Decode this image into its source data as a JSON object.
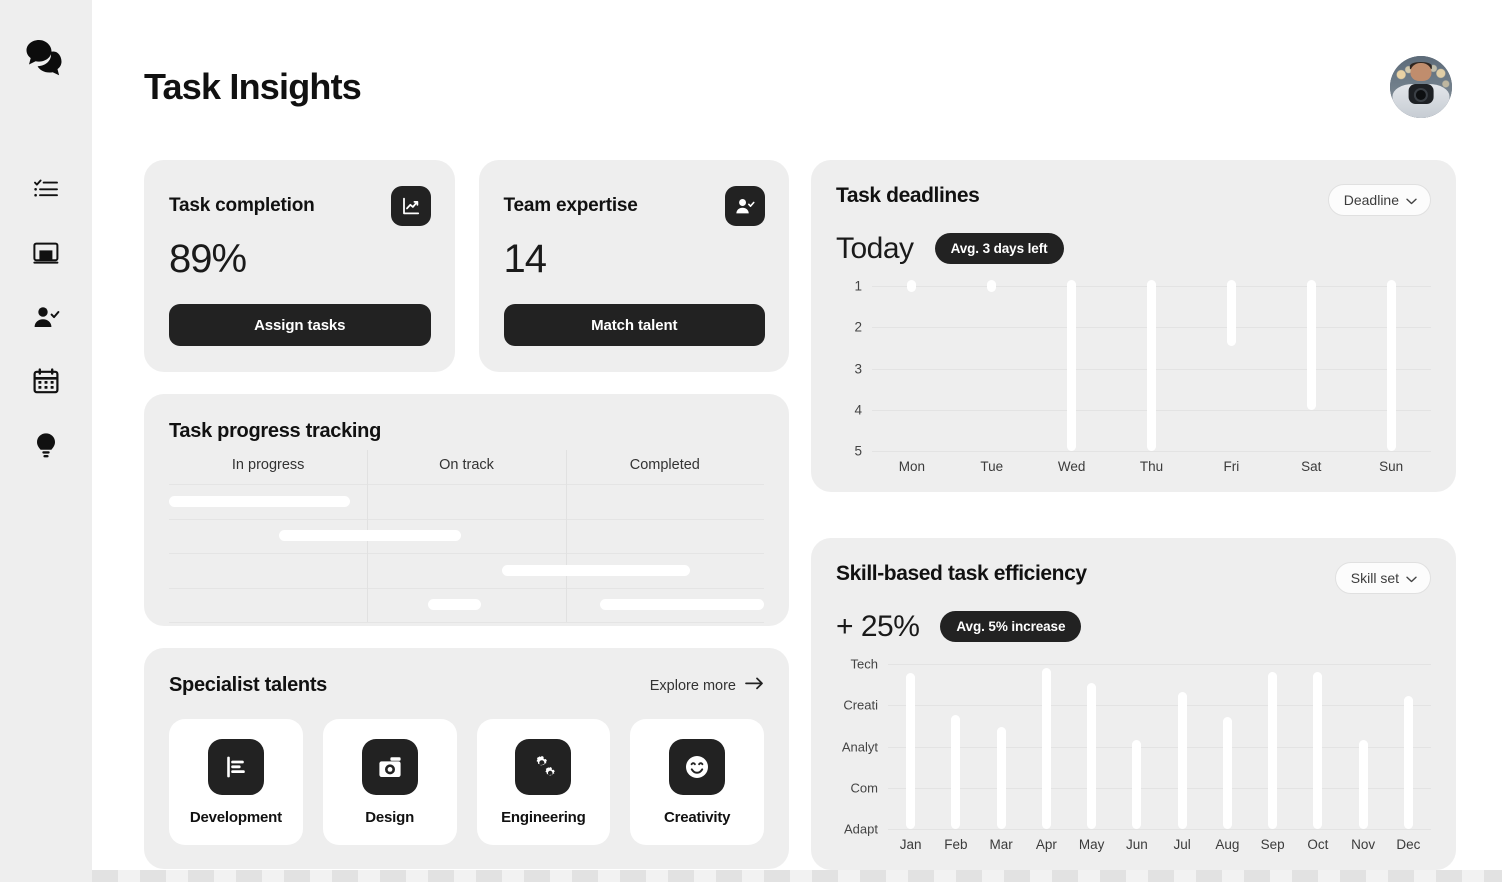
{
  "accent": "#222222",
  "surface": "#eeeeee",
  "background": "#ffffff",
  "sidebar": {
    "logo_icon": "chat-bubbles-icon",
    "items": [
      {
        "icon": "checklist-icon",
        "name": "tasks"
      },
      {
        "icon": "board-icon",
        "name": "board"
      },
      {
        "icon": "user-check-icon",
        "name": "people"
      },
      {
        "icon": "calendar-icon",
        "name": "calendar"
      },
      {
        "icon": "lightbulb-icon",
        "name": "ideas"
      }
    ]
  },
  "header": {
    "title": "Task Insights",
    "avatar_icon": "user-avatar-photo"
  },
  "stats": [
    {
      "title": "Task completion",
      "value": "89%",
      "button": "Assign tasks",
      "icon": "line-chart-icon"
    },
    {
      "title": "Team expertise",
      "value": "14",
      "button": "Match talent",
      "icon": "user-check-icon"
    }
  ],
  "progress": {
    "title": "Task progress tracking",
    "columns": [
      "In progress",
      "On track",
      "Completed"
    ],
    "bars": [
      {
        "row": 0,
        "start": 0.0,
        "end": 0.305
      },
      {
        "row": 1,
        "start": 0.185,
        "end": 0.49
      },
      {
        "row": 2,
        "start": 0.56,
        "end": 0.875
      },
      {
        "row": 3,
        "start": 0.435,
        "end": 0.525
      },
      {
        "row": 3,
        "start": 0.725,
        "end": 1.0
      }
    ]
  },
  "talents": {
    "title": "Specialist talents",
    "explore_label": "Explore more",
    "explore_icon": "arrow-right-icon",
    "items": [
      {
        "label": "Development",
        "icon": "bar-chart-doc-icon"
      },
      {
        "label": "Design",
        "icon": "camera-icon"
      },
      {
        "label": "Engineering",
        "icon": "gears-icon"
      },
      {
        "label": "Creativity",
        "icon": "smiley-icon"
      }
    ]
  },
  "deadlines": {
    "title": "Task deadlines",
    "filter_label": "Deadline",
    "filter_icon": "chevron-down-icon",
    "headline": "Today",
    "badge": "Avg. 3 days left"
  },
  "efficiency": {
    "title": "Skill-based task efficiency",
    "filter_label": "Skill set",
    "filter_icon": "chevron-down-icon",
    "headline": "+ 25%",
    "badge": "Avg. 5% increase"
  },
  "chart_data": [
    {
      "id": "task-deadlines",
      "type": "bar",
      "title": "Task deadlines",
      "orientation": "downward",
      "categories": [
        "Mon",
        "Tue",
        "Wed",
        "Thu",
        "Fri",
        "Sat",
        "Sun"
      ],
      "values": [
        1.15,
        1.15,
        5.0,
        5.0,
        2.45,
        4.0,
        5.0
      ],
      "xlabel": "",
      "ylabel": "",
      "yticks": [
        "1",
        "2",
        "3",
        "4",
        "5"
      ],
      "ylim": [
        1,
        5
      ],
      "y_axis_inverted": true,
      "grid": true,
      "legend": "none",
      "annotation": "Avg. 3 days left"
    },
    {
      "id": "skill-based-task-efficiency",
      "type": "bar",
      "title": "Skill-based task efficiency",
      "orientation": "upward",
      "categories": [
        "Jan",
        "Feb",
        "Mar",
        "Apr",
        "May",
        "Jun",
        "Jul",
        "Aug",
        "Sep",
        "Oct",
        "Nov",
        "Dec"
      ],
      "values": [
        4.1,
        3.0,
        2.7,
        4.25,
        3.85,
        2.35,
        3.6,
        2.95,
        4.15,
        4.15,
        2.35,
        3.5
      ],
      "xlabel": "",
      "ylabel": "",
      "yticks": [
        "Tech",
        "Creati",
        "Analyt",
        "Com",
        "Adapt"
      ],
      "ylim": [
        0,
        4.35
      ],
      "grid": true,
      "legend": "none",
      "annotation": "Avg. 5% increase"
    }
  ]
}
